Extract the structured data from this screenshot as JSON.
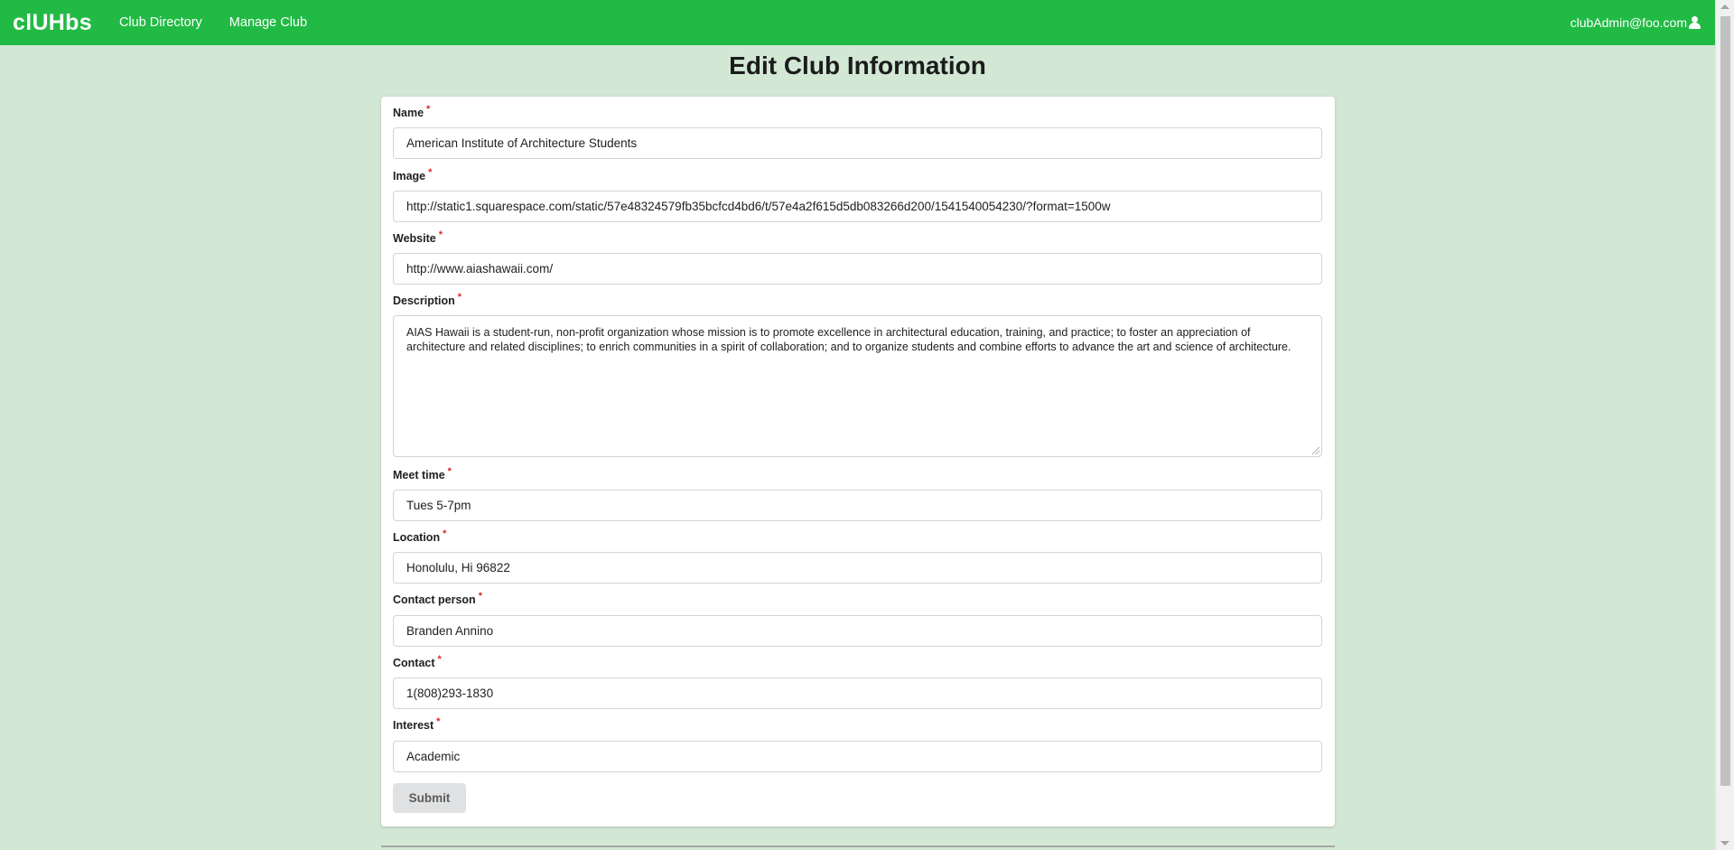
{
  "navbar": {
    "brand": "clUHbs",
    "links": [
      "Club Directory",
      "Manage Club"
    ],
    "user_email": "clubAdmin@foo.com",
    "color": "#21ba45"
  },
  "page": {
    "title": "Edit Club Information",
    "background": "#d3e8d4"
  },
  "form": {
    "required_marker": "*",
    "fields": {
      "name": {
        "label": "Name",
        "value": "American Institute of Architecture Students"
      },
      "image": {
        "label": "Image",
        "value": "http://static1.squarespace.com/static/57e48324579fb35bcfcd4bd6/t/57e4a2f615d5db083266d200/1541540054230/?format=1500w"
      },
      "website": {
        "label": "Website",
        "value": "http://www.aiashawaii.com/"
      },
      "description": {
        "label": "Description",
        "value": "AIAS Hawaii is a student-run, non-profit organization whose mission is to promote excellence in architectural education, training, and practice; to foster an appreciation of architecture and related disciplines; to enrich communities in a spirit of collaboration; and to organize students and combine efforts to advance the art and science of architecture."
      },
      "meet_time": {
        "label": "Meet time",
        "value": "Tues 5-7pm"
      },
      "location": {
        "label": "Location",
        "value": "Honolulu, Hi 96822"
      },
      "contact_person": {
        "label": "Contact person",
        "value": "Branden Annino"
      },
      "contact": {
        "label": "Contact",
        "value": "1(808)293-1830"
      },
      "interest": {
        "label": "Interest",
        "value": "Academic"
      }
    },
    "submit_label": "Submit"
  },
  "icons": {
    "user": "user-icon"
  }
}
